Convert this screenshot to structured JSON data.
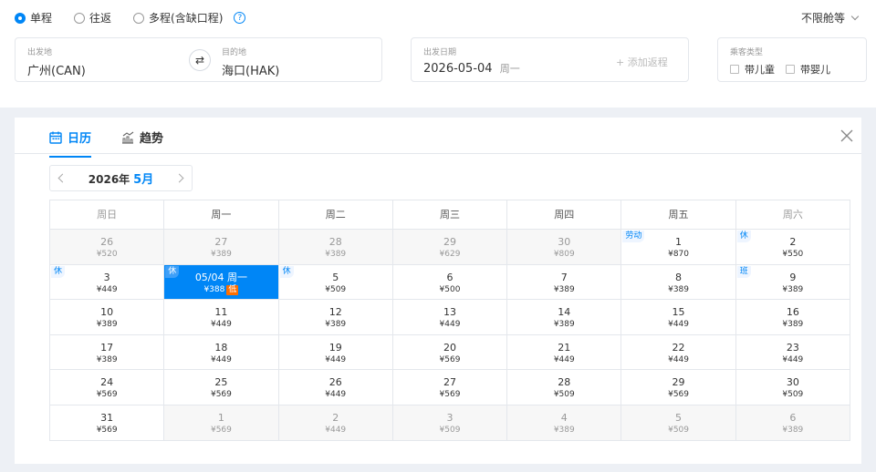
{
  "trip_types": [
    {
      "label": "单程",
      "selected": true
    },
    {
      "label": "往返",
      "selected": false
    },
    {
      "label": "多程(含缺口程)",
      "selected": false
    }
  ],
  "help_icon": "?",
  "cabin": {
    "label": "不限舱等"
  },
  "origin": {
    "caption": "出发地",
    "value": "广州(CAN)"
  },
  "swap_icon": "⇄",
  "destination": {
    "caption": "目的地",
    "value": "海口(HAK)"
  },
  "date": {
    "caption": "出发日期",
    "value": "2026-05-04",
    "weekday": "周一",
    "add_return": "+ 添加返程"
  },
  "passengers": {
    "caption": "乘客类型",
    "options": [
      "带儿童",
      "带婴儿"
    ]
  },
  "tabs": [
    {
      "label": "日历",
      "icon": "calendar-icon",
      "active": true
    },
    {
      "label": "趋势",
      "icon": "trend-chart-icon",
      "active": false
    }
  ],
  "calendar": {
    "year": "2026年",
    "month": "5月",
    "weekdays": [
      "周日",
      "周一",
      "周二",
      "周三",
      "周四",
      "周五",
      "周六"
    ],
    "weeks": [
      [
        {
          "day": "26",
          "price": "¥520",
          "out": true
        },
        {
          "day": "27",
          "price": "¥389",
          "out": true
        },
        {
          "day": "28",
          "price": "¥389",
          "out": true
        },
        {
          "day": "29",
          "price": "¥629",
          "out": true
        },
        {
          "day": "30",
          "price": "¥809",
          "out": true
        },
        {
          "day": "1",
          "price": "¥870",
          "tag": "劳动"
        },
        {
          "day": "2",
          "price": "¥550",
          "tag": "休"
        }
      ],
      [
        {
          "day": "3",
          "price": "¥449",
          "tag": "休"
        },
        {
          "day": "05/04 周一",
          "price": "¥388",
          "tag": "休",
          "selected": true,
          "badge": "低"
        },
        {
          "day": "5",
          "price": "¥509",
          "tag": "休"
        },
        {
          "day": "6",
          "price": "¥500"
        },
        {
          "day": "7",
          "price": "¥389"
        },
        {
          "day": "8",
          "price": "¥389"
        },
        {
          "day": "9",
          "price": "¥389",
          "tag": "班"
        }
      ],
      [
        {
          "day": "10",
          "price": "¥389"
        },
        {
          "day": "11",
          "price": "¥449"
        },
        {
          "day": "12",
          "price": "¥389"
        },
        {
          "day": "13",
          "price": "¥449"
        },
        {
          "day": "14",
          "price": "¥389"
        },
        {
          "day": "15",
          "price": "¥449"
        },
        {
          "day": "16",
          "price": "¥389"
        }
      ],
      [
        {
          "day": "17",
          "price": "¥389"
        },
        {
          "day": "18",
          "price": "¥449"
        },
        {
          "day": "19",
          "price": "¥449"
        },
        {
          "day": "20",
          "price": "¥569"
        },
        {
          "day": "21",
          "price": "¥449"
        },
        {
          "day": "22",
          "price": "¥449"
        },
        {
          "day": "23",
          "price": "¥449"
        }
      ],
      [
        {
          "day": "24",
          "price": "¥569"
        },
        {
          "day": "25",
          "price": "¥569"
        },
        {
          "day": "26",
          "price": "¥449"
        },
        {
          "day": "27",
          "price": "¥569"
        },
        {
          "day": "28",
          "price": "¥509"
        },
        {
          "day": "29",
          "price": "¥569"
        },
        {
          "day": "30",
          "price": "¥509"
        }
      ],
      [
        {
          "day": "31",
          "price": "¥569"
        },
        {
          "day": "1",
          "price": "¥569",
          "out": true
        },
        {
          "day": "2",
          "price": "¥449",
          "out": true
        },
        {
          "day": "3",
          "price": "¥509",
          "out": true
        },
        {
          "day": "4",
          "price": "¥389",
          "out": true
        },
        {
          "day": "5",
          "price": "¥509",
          "out": true
        },
        {
          "day": "6",
          "price": "¥389",
          "out": true
        }
      ]
    ]
  }
}
